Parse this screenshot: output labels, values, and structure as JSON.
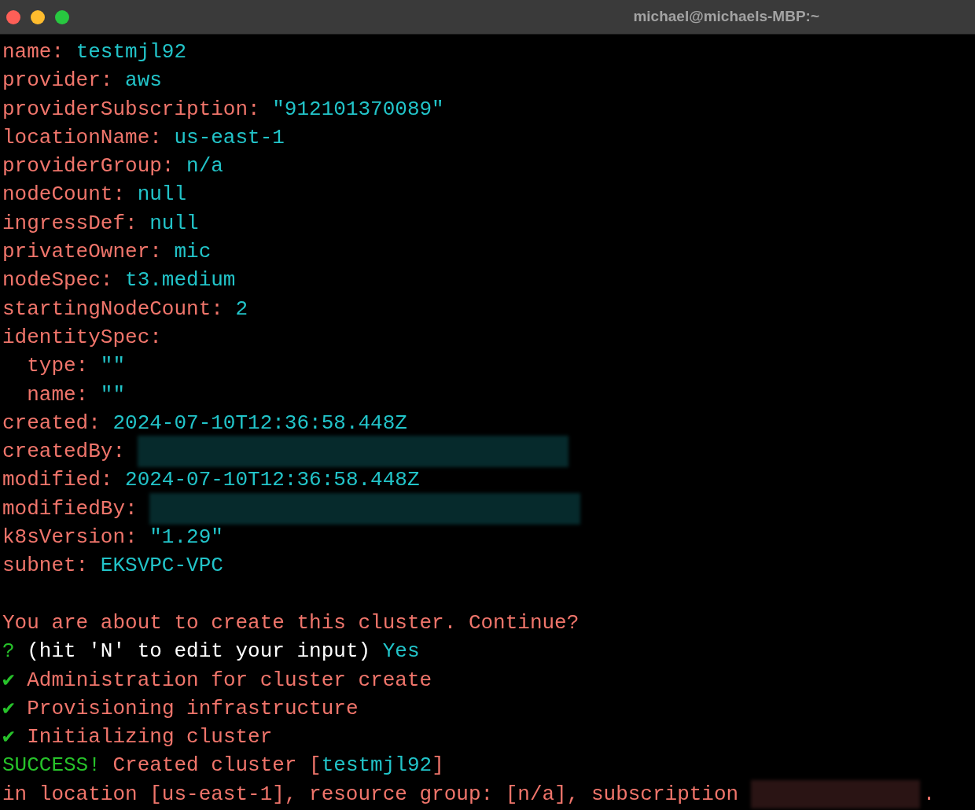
{
  "window": {
    "title": "michael@michaels-MBP:~"
  },
  "lines": [
    {
      "kind": "text",
      "segments": [
        {
          "kind": "key",
          "text": "name: "
        },
        {
          "kind": "value",
          "text": "testmjl92"
        }
      ]
    },
    {
      "kind": "text",
      "segments": [
        {
          "kind": "key",
          "text": "provider: "
        },
        {
          "kind": "value",
          "text": "aws"
        }
      ]
    },
    {
      "kind": "text",
      "segments": [
        {
          "kind": "key",
          "text": "providerSubscription: "
        },
        {
          "kind": "value",
          "text": "\"912101370089\""
        }
      ]
    },
    {
      "kind": "text",
      "segments": [
        {
          "kind": "key",
          "text": "locationName: "
        },
        {
          "kind": "value",
          "text": "us-east-1"
        }
      ]
    },
    {
      "kind": "text",
      "segments": [
        {
          "kind": "key",
          "text": "providerGroup: "
        },
        {
          "kind": "value",
          "text": "n/a"
        }
      ]
    },
    {
      "kind": "text",
      "segments": [
        {
          "kind": "key",
          "text": "nodeCount: "
        },
        {
          "kind": "value",
          "text": "null"
        }
      ]
    },
    {
      "kind": "text",
      "segments": [
        {
          "kind": "key",
          "text": "ingressDef: "
        },
        {
          "kind": "value",
          "text": "null"
        }
      ]
    },
    {
      "kind": "text",
      "segments": [
        {
          "kind": "key",
          "text": "privateOwner: "
        },
        {
          "kind": "value",
          "text": "mic"
        }
      ]
    },
    {
      "kind": "text",
      "segments": [
        {
          "kind": "key",
          "text": "nodeSpec: "
        },
        {
          "kind": "value",
          "text": "t3.medium"
        }
      ]
    },
    {
      "kind": "text",
      "segments": [
        {
          "kind": "key",
          "text": "startingNodeCount: "
        },
        {
          "kind": "value",
          "text": "2"
        }
      ]
    },
    {
      "kind": "text",
      "segments": [
        {
          "kind": "key",
          "text": "identitySpec:"
        }
      ]
    },
    {
      "kind": "text",
      "segments": [
        {
          "kind": "key",
          "text": "  type: "
        },
        {
          "kind": "value",
          "text": "\"\""
        }
      ]
    },
    {
      "kind": "text",
      "segments": [
        {
          "kind": "key",
          "text": "  name: "
        },
        {
          "kind": "value",
          "text": "\"\""
        }
      ]
    },
    {
      "kind": "text",
      "segments": [
        {
          "kind": "key",
          "text": "created: "
        },
        {
          "kind": "value",
          "text": "2024-07-10T12:36:58.448Z"
        }
      ]
    },
    {
      "kind": "text",
      "segments": [
        {
          "kind": "key",
          "text": "createdBy: "
        },
        {
          "kind": "redacted-long"
        }
      ]
    },
    {
      "kind": "text",
      "segments": [
        {
          "kind": "key",
          "text": "modified: "
        },
        {
          "kind": "value",
          "text": "2024-07-10T12:36:58.448Z"
        }
      ]
    },
    {
      "kind": "text",
      "segments": [
        {
          "kind": "key",
          "text": "modifiedBy: "
        },
        {
          "kind": "redacted-long"
        }
      ]
    },
    {
      "kind": "text",
      "segments": [
        {
          "kind": "key",
          "text": "k8sVersion: "
        },
        {
          "kind": "value",
          "text": "\"1.29\""
        }
      ]
    },
    {
      "kind": "text",
      "segments": [
        {
          "kind": "key",
          "text": "subnet: "
        },
        {
          "kind": "value",
          "text": "EKSVPC-VPC"
        }
      ]
    },
    {
      "kind": "blank"
    },
    {
      "kind": "text",
      "segments": [
        {
          "kind": "message",
          "text": "You are about to create this cluster. Continue?"
        }
      ]
    },
    {
      "kind": "text",
      "segments": [
        {
          "kind": "prompt",
          "text": "? "
        },
        {
          "kind": "question",
          "text": "(hit 'N' to edit your input) "
        },
        {
          "kind": "value",
          "text": "Yes"
        }
      ]
    },
    {
      "kind": "text",
      "segments": [
        {
          "kind": "check",
          "text": "✔ "
        },
        {
          "kind": "message",
          "text": "Administration for cluster create"
        }
      ]
    },
    {
      "kind": "text",
      "segments": [
        {
          "kind": "check",
          "text": "✔ "
        },
        {
          "kind": "message",
          "text": "Provisioning infrastructure"
        }
      ]
    },
    {
      "kind": "text",
      "segments": [
        {
          "kind": "check",
          "text": "✔ "
        },
        {
          "kind": "message",
          "text": "Initializing cluster"
        }
      ]
    },
    {
      "kind": "text",
      "segments": [
        {
          "kind": "success",
          "text": "SUCCESS! "
        },
        {
          "kind": "message",
          "text": "Created cluster ["
        },
        {
          "kind": "value",
          "text": "testmjl92"
        },
        {
          "kind": "message",
          "text": "]"
        }
      ]
    },
    {
      "kind": "text",
      "segments": [
        {
          "kind": "message",
          "text": "in location [us-east-1], resource group: [n/a], subscription "
        },
        {
          "kind": "redacted-short"
        },
        {
          "kind": "message",
          "text": "."
        }
      ]
    }
  ]
}
